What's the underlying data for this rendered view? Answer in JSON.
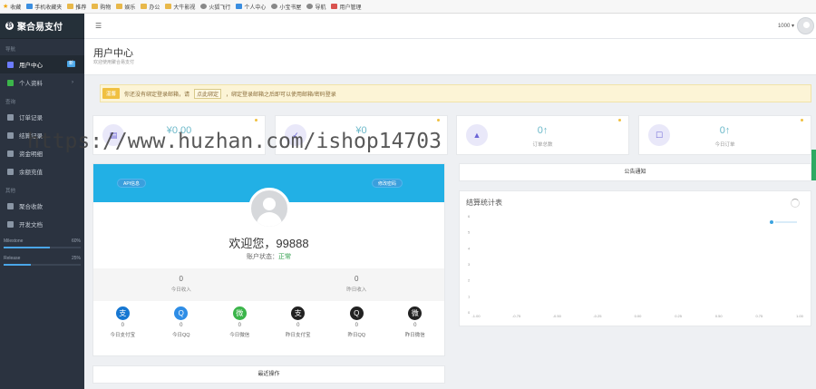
{
  "bookmarks": [
    {
      "label": "收藏",
      "icon": "star-icon"
    },
    {
      "label": "手机收藏夹",
      "icon": "phone-icon"
    },
    {
      "label": "推荐",
      "icon": "folder-icon"
    },
    {
      "label": "购物",
      "icon": "folder-icon"
    },
    {
      "label": "娱乐",
      "icon": "folder-icon"
    },
    {
      "label": "办公",
      "icon": "folder-icon"
    },
    {
      "label": "大牛影视",
      "icon": "folder-icon"
    },
    {
      "label": "火狐飞行",
      "icon": "globe-icon"
    },
    {
      "label": "个人中心",
      "icon": "user-icon"
    },
    {
      "label": "小宝书屋",
      "icon": "globe-icon"
    },
    {
      "label": "导航",
      "icon": "globe-icon"
    },
    {
      "label": "用户管理",
      "icon": "chart-icon"
    }
  ],
  "brand": {
    "name": "聚合易支付"
  },
  "sidebar": {
    "section_main": "导航",
    "items_main": [
      {
        "label": "用户中心",
        "badge": "新",
        "active": true
      },
      {
        "label": "个人资料",
        "chevron": "›"
      }
    ],
    "section_data": "查询",
    "items_data": [
      {
        "label": "订单记录"
      },
      {
        "label": "结算记录"
      },
      {
        "label": "资金明细"
      },
      {
        "label": "余额充值"
      }
    ],
    "section_other": "其他",
    "items_other": [
      {
        "label": "聚合收款"
      },
      {
        "label": "开发文档"
      }
    ],
    "progress": [
      {
        "label": "Milestone",
        "value_text": "60%",
        "fraction": 0.6
      },
      {
        "label": "Release",
        "value_text": "25%",
        "fraction": 0.35
      }
    ]
  },
  "topbar": {
    "menu_icon": "menu-icon",
    "user_id": "1000 ▾"
  },
  "page": {
    "title": "用户中心",
    "subtitle": "欢迎使用聚合易支付"
  },
  "notice": {
    "tag": "温馨",
    "text_before": "你还没有绑定登录邮箱，请",
    "link": "点此绑定",
    "text_after": "，绑定登录邮箱之后即可以使用邮箱/密码登录"
  },
  "cards": [
    {
      "value": "¥0.00",
      "label": "",
      "icon": "money-icon"
    },
    {
      "value": "¥0",
      "label": "",
      "icon": "check-icon"
    },
    {
      "value": "0↑",
      "label": "订单总数",
      "icon": "area-chart-icon"
    },
    {
      "value": "0↑",
      "label": "今日订单",
      "icon": "cart-icon"
    }
  ],
  "profile": {
    "btn_left": "API信息",
    "btn_right": "修改密码",
    "welcome": "欢迎您，99888",
    "status_label": "账户状态：",
    "status_value": "正常",
    "today_left_num": "0",
    "today_left_cap": "今日收入",
    "today_right_num": "0",
    "today_right_cap": "昨日收入",
    "pay": [
      {
        "icon": "alipay-icon",
        "glyph": "支",
        "color": "#1677d2",
        "num": "0",
        "cap": "今日支付宝"
      },
      {
        "icon": "qq-icon",
        "glyph": "Q",
        "color": "#2e8de6",
        "num": "0",
        "cap": "今日QQ"
      },
      {
        "icon": "wechat-icon",
        "glyph": "微",
        "color": "#3bb54a",
        "num": "0",
        "cap": "今日微信"
      },
      {
        "icon": "alipay-icon",
        "glyph": "支",
        "color": "#222222",
        "num": "0",
        "cap": "昨日支付宝"
      },
      {
        "icon": "qq-icon",
        "glyph": "Q",
        "color": "#222222",
        "num": "0",
        "cap": "昨日QQ"
      },
      {
        "icon": "wechat-icon",
        "glyph": "微",
        "color": "#222222",
        "num": "0",
        "cap": "昨日微信"
      }
    ]
  },
  "bottom_panel": {
    "title": "最近操作"
  },
  "announce": {
    "title": "公告通知"
  },
  "trend": {
    "title": "结算统计表"
  },
  "watermark": "https://www.huzhan.com/ishop14703",
  "colors": {
    "accent": "#22b0e5",
    "sidebar": "#2b3340",
    "success": "#2e9e4a",
    "warning": "#f0c040"
  },
  "chart_data": {
    "type": "line",
    "title": "结算统计表",
    "x": [
      "-1.00",
      "-0.75",
      "-0.50",
      "-0.25",
      "0.00",
      "0.25",
      "0.50",
      "0.75",
      "1.00"
    ],
    "y_ticks": [
      "0",
      "1",
      "2",
      "3",
      "4",
      "5",
      "6"
    ],
    "ylim": [
      0,
      6
    ],
    "series": [
      {
        "values": []
      }
    ],
    "legend": "top-right"
  }
}
